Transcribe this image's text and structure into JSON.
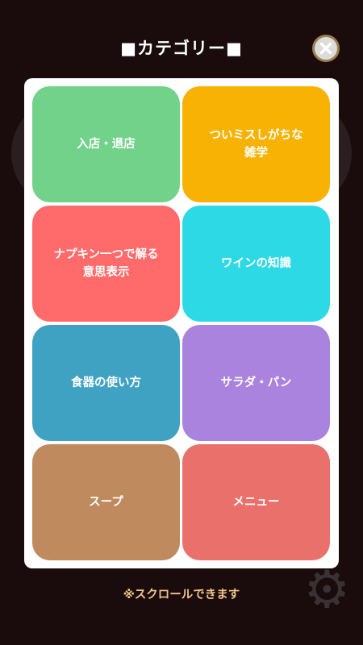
{
  "header": {
    "title": "■カテゴリー■",
    "close_icon": "close-x-icon"
  },
  "categories": [
    {
      "label": "入店・退店",
      "color": "#72d289"
    },
    {
      "label": "ついミスしがちな\n雑学",
      "color": "#f7b204"
    },
    {
      "label": "ナプキン一つで解る\n意思表示",
      "color": "#ff6a6a"
    },
    {
      "label": "ワインの知識",
      "color": "#2ed9e6"
    },
    {
      "label": "食器の使い方",
      "color": "#40a2c2"
    },
    {
      "label": "サラダ・パン",
      "color": "#a983dd"
    },
    {
      "label": "スープ",
      "color": "#bf8a5e"
    },
    {
      "label": "メニュー",
      "color": "#e9706b"
    }
  ],
  "footer": {
    "hint": "※スクロールできます"
  },
  "background": {
    "gear_icon": "gear-icon"
  }
}
